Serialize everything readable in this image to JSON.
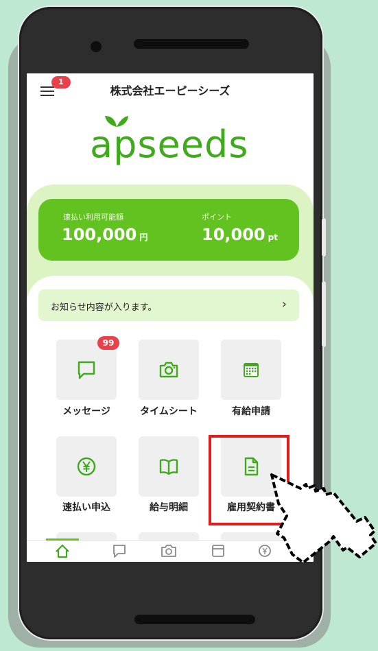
{
  "header": {
    "company_name": "株式会社エーピーシーズ",
    "menu_badge_count": "1"
  },
  "logo": {
    "text": "apseeds"
  },
  "balance": {
    "advance_label": "速払い利用可能額",
    "advance_value": "100,000",
    "advance_unit": "円",
    "points_label": "ポイント",
    "points_value": "10,000",
    "points_unit": "pt"
  },
  "notice": {
    "text": "お知らせ内容が入ります。",
    "chevron": "›"
  },
  "menu_tiles": [
    {
      "label": "メッセージ",
      "icon": "chat-bubble-icon",
      "badge": "99"
    },
    {
      "label": "タイムシート",
      "icon": "camera-icon"
    },
    {
      "label": "有給申請",
      "icon": "calendar-icon"
    },
    {
      "label": "速払い申込",
      "icon": "yen-circle-icon"
    },
    {
      "label": "給与明細",
      "icon": "open-book-icon"
    },
    {
      "label": "雇用契約書",
      "icon": "document-icon",
      "highlighted": true
    },
    {
      "label": "",
      "icon": "envelope-icon"
    },
    {
      "label": "",
      "icon": "check-circle-icon"
    },
    {
      "label": "",
      "icon": "paperclip-icon"
    }
  ],
  "tabbar": {
    "tabs": [
      {
        "icon": "home-icon",
        "active": true
      },
      {
        "icon": "chat-bubble-icon"
      },
      {
        "icon": "camera-icon"
      },
      {
        "icon": "calendar-icon"
      },
      {
        "icon": "yen-circle-icon"
      }
    ],
    "more_arrow": "›"
  },
  "colors": {
    "background": "#bfe8d2",
    "brand_green": "#62c21f",
    "logo_green": "#3eaa1c",
    "light_green": "#dcf3c4",
    "badge_red": "#e8414b",
    "highlight_red": "#e31b1b"
  }
}
